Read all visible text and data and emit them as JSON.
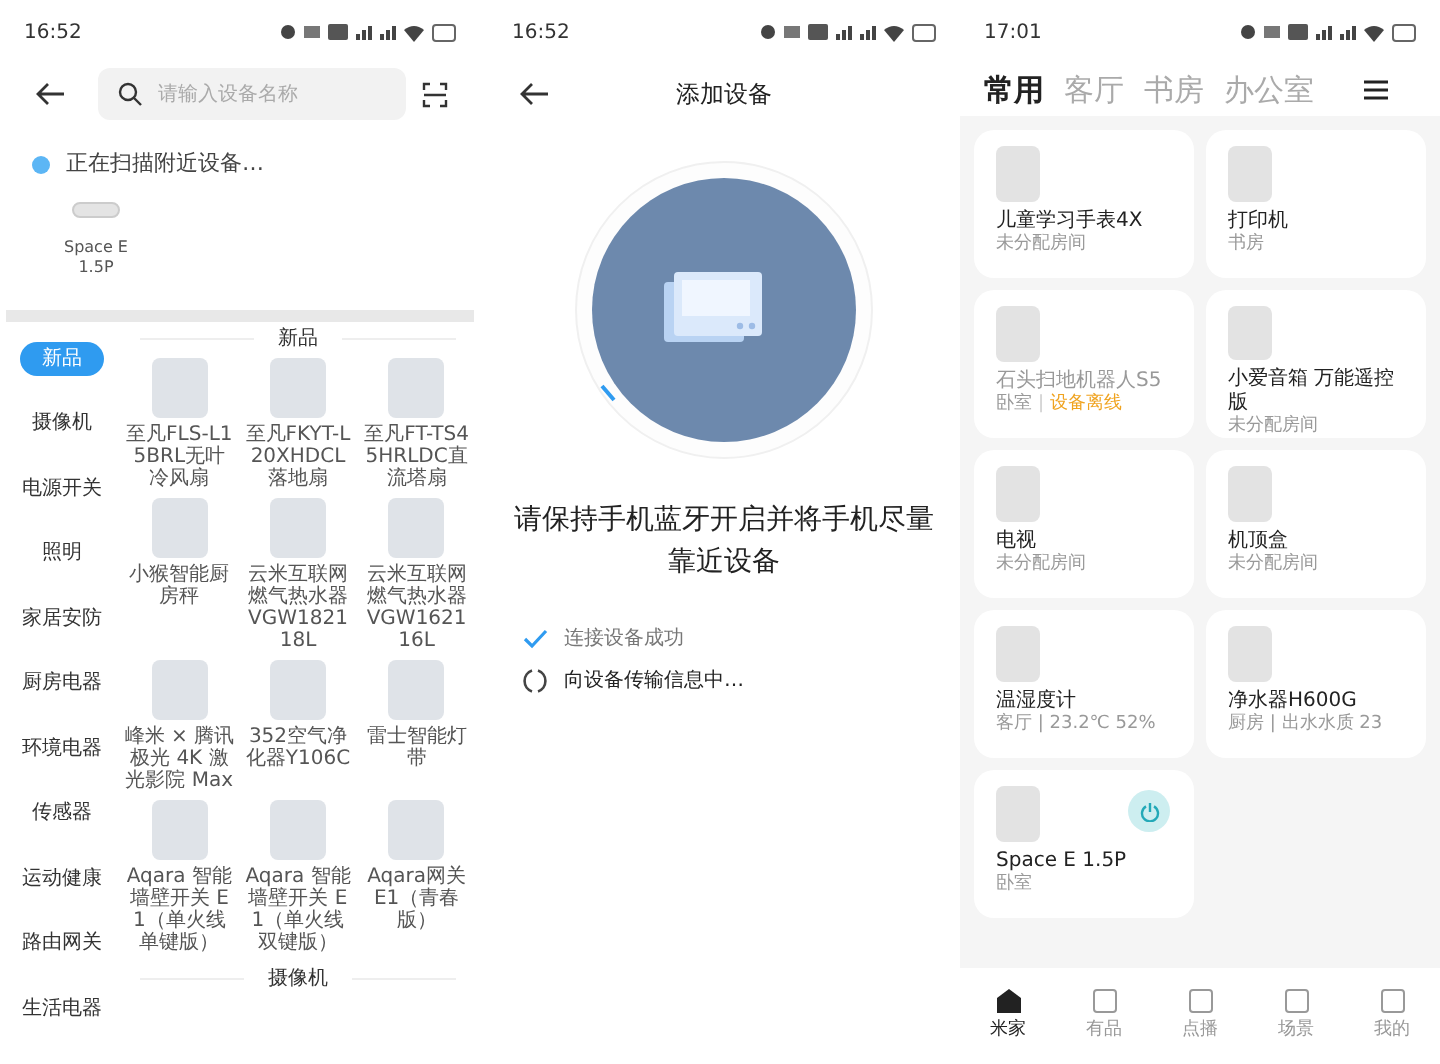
{
  "search_screen": {
    "status_time": "16:52",
    "search": {
      "placeholder": "请输入设备名称"
    },
    "scan_text": "正在扫描附近设备…",
    "nearby": [
      {
        "name": "Space E 1.5P"
      }
    ],
    "categories": [
      {
        "label": "新品",
        "selected": true
      },
      {
        "label": "摄像机",
        "selected": false
      },
      {
        "label": "电源开关",
        "selected": false
      },
      {
        "label": "照明",
        "selected": false
      },
      {
        "label": "家居安防",
        "selected": false
      },
      {
        "label": "厨房电器",
        "selected": false
      },
      {
        "label": "环境电器",
        "selected": false
      },
      {
        "label": "传感器",
        "selected": false
      },
      {
        "label": "运动健康",
        "selected": false
      },
      {
        "label": "路由网关",
        "selected": false
      },
      {
        "label": "生活电器",
        "selected": false
      }
    ],
    "sections": [
      {
        "title": "新品",
        "products": [
          {
            "name": "至凡FLS-L15BRL无叶冷风扇"
          },
          {
            "name": "至凡FKYT-L20XHDCL落地扇"
          },
          {
            "name": "至凡FT-TS45HRLDC直流塔扇"
          },
          {
            "name": "小猴智能厨房秤"
          },
          {
            "name": "云米互联网燃气热水器VGW182118L"
          },
          {
            "name": "云米互联网燃气热水器VGW162116L"
          },
          {
            "name": "峰米 × 腾讯极光 4K 激光影院 Max"
          },
          {
            "name": "352空气净化器Y106C"
          },
          {
            "name": "雷士智能灯带"
          },
          {
            "name": "Aqara 智能墙壁开关 E1（单火线单键版）"
          },
          {
            "name": "Aqara 智能墙壁开关 E1（单火线双键版）"
          },
          {
            "name": "Aqara网关E1（青春版）"
          }
        ]
      },
      {
        "title": "摄像机"
      }
    ]
  },
  "add_screen": {
    "status_time": "16:52",
    "title": "添加设备",
    "instruction": "请保持手机蓝牙开启并将手机尽量靠近设备",
    "steps": [
      {
        "text": "连接设备成功",
        "done": true
      },
      {
        "text": "向设备传输信息中…",
        "done": false
      }
    ]
  },
  "home_screen": {
    "status_time": "17:01",
    "tabs": [
      {
        "label": "常用",
        "selected": true
      },
      {
        "label": "客厅",
        "selected": false
      },
      {
        "label": "书房",
        "selected": false
      },
      {
        "label": "办公室",
        "selected": false
      }
    ],
    "devices": [
      {
        "name": "儿童学习手表4X",
        "room": "未分配房间",
        "offline": false,
        "kind": "plain"
      },
      {
        "name": "打印机",
        "room": "书房",
        "offline": false,
        "kind": "plain"
      },
      {
        "name": "石头扫地机器人S5",
        "room": "卧室",
        "separator": "|",
        "status": "设备离线",
        "offline": true,
        "kind": "plain"
      },
      {
        "name": "小爱音箱 万能遥控版",
        "room": "未分配房间",
        "offline": false,
        "kind": "plain"
      },
      {
        "name": "电视",
        "room": "未分配房间",
        "offline": false,
        "kind": "plain"
      },
      {
        "name": "机顶盒",
        "room": "未分配房间",
        "offline": false,
        "kind": "plain"
      },
      {
        "name": "温湿度计",
        "room": "客厅 | 23.2℃ 52%",
        "offline": false,
        "kind": "plain"
      },
      {
        "name": "净水器H600G",
        "room": "厨房 | 出水水质 23",
        "offline": false,
        "kind": "plain"
      },
      {
        "name": "Space E 1.5P",
        "room": "卧室",
        "offline": false,
        "kind": "power"
      }
    ],
    "nav": [
      {
        "label": "米家",
        "selected": true
      },
      {
        "label": "有品",
        "selected": false
      },
      {
        "label": "点播",
        "selected": false
      },
      {
        "label": "场景",
        "selected": false
      },
      {
        "label": "我的",
        "selected": false
      }
    ]
  }
}
